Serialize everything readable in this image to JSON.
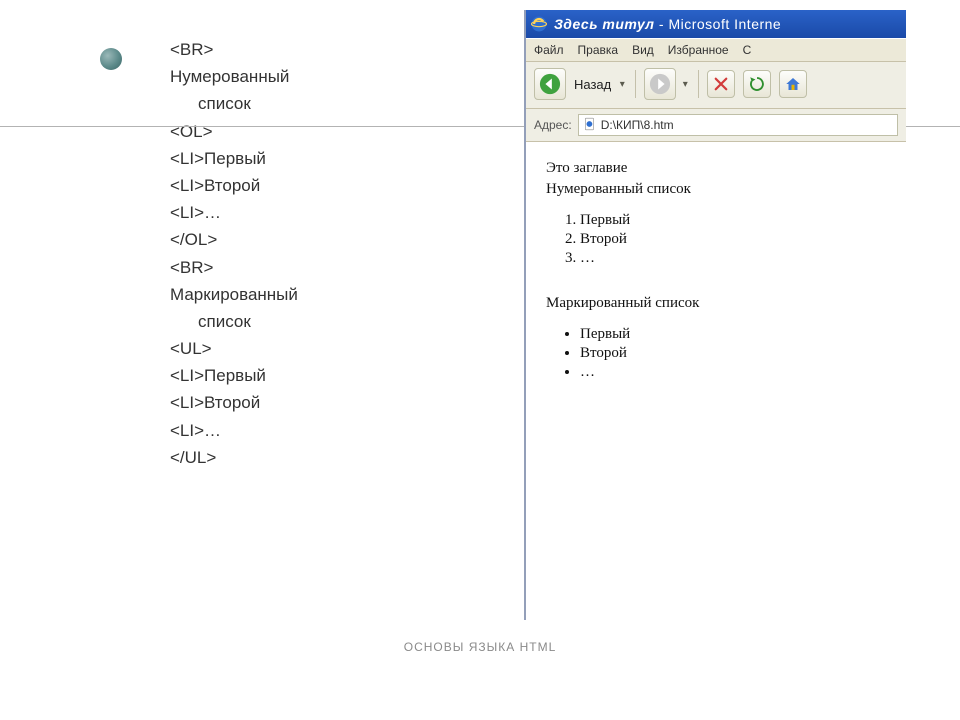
{
  "code": {
    "lines": [
      {
        "text": "<BR>",
        "indent": 0
      },
      {
        "text": "Нумерованный",
        "indent": 0
      },
      {
        "text": "список",
        "indent": 1
      },
      {
        "text": "<OL>",
        "indent": 0
      },
      {
        "text": "<LI>Первый",
        "indent": 0
      },
      {
        "text": "<LI>Второй",
        "indent": 0
      },
      {
        "text": "<LI>…",
        "indent": 0
      },
      {
        "text": "</OL>",
        "indent": 0
      },
      {
        "text": "<BR>",
        "indent": 0
      },
      {
        "text": "Маркированный",
        "indent": 0
      },
      {
        "text": "список",
        "indent": 1
      },
      {
        "text": "<UL>",
        "indent": 0
      },
      {
        "text": "<LI>Первый",
        "indent": 0
      },
      {
        "text": "<LI>Второй",
        "indent": 0
      },
      {
        "text": "<LI>…",
        "indent": 0
      },
      {
        "text": "</UL>",
        "indent": 0
      }
    ]
  },
  "footer": "ОСНОВЫ ЯЗЫКА HTML",
  "browser": {
    "title_prefix": "Здесь титул",
    "title_suffix": "- Microsoft Interne",
    "menus": [
      "Файл",
      "Правка",
      "Вид",
      "Избранное",
      "С"
    ],
    "back_label": "Назад",
    "address_label": "Адрес:",
    "address_value": "D:\\КИП\\8.htm"
  },
  "page": {
    "heading1": "Это заглавие",
    "heading2": "Нумерованный список",
    "ol": [
      "Первый",
      "Второй",
      "…"
    ],
    "heading3": "Маркированный список",
    "ul": [
      "Первый",
      "Второй",
      "…"
    ]
  }
}
